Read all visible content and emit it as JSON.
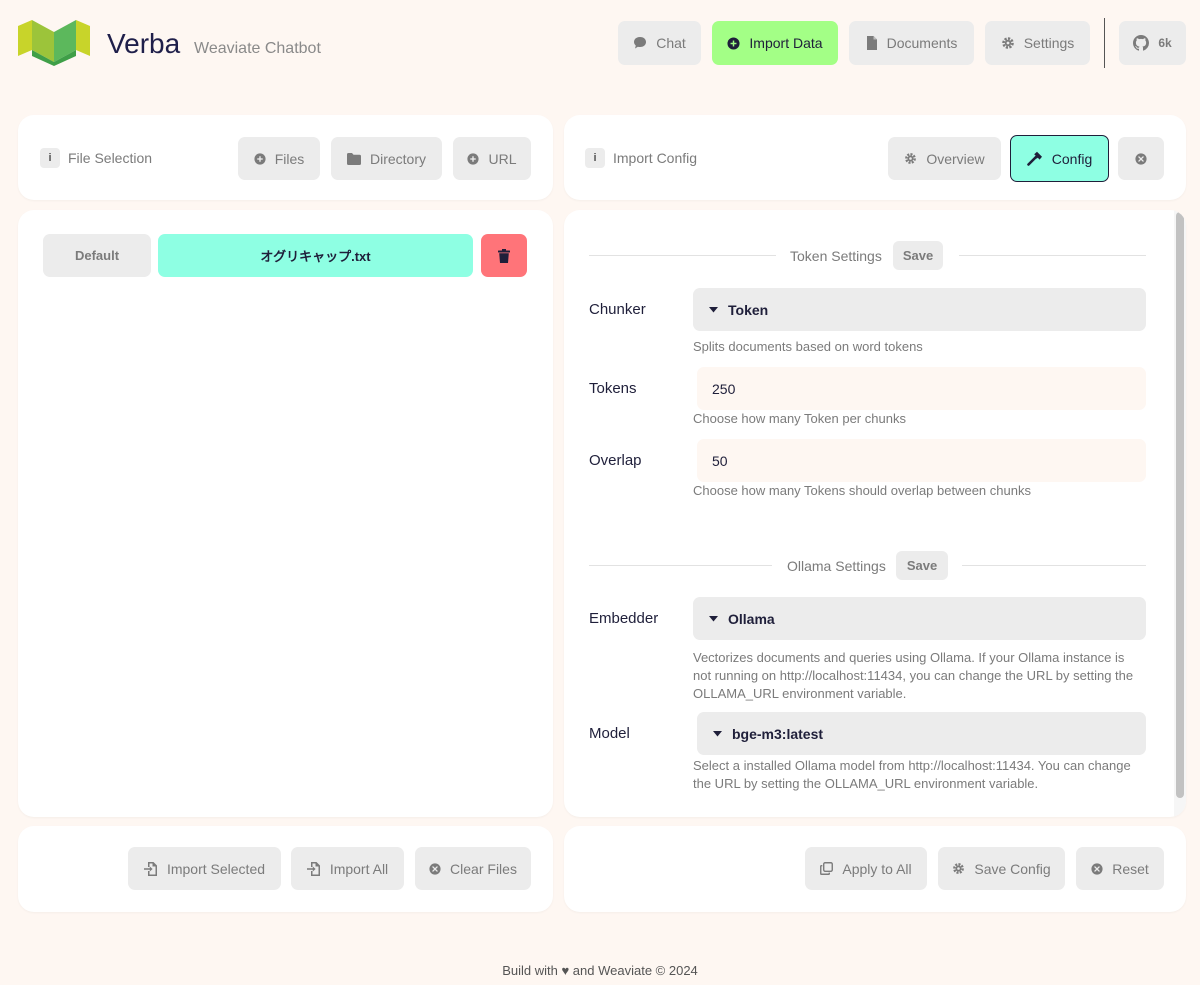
{
  "app": {
    "title": "Verba",
    "subtitle": "Weaviate Chatbot"
  },
  "nav": {
    "chat": "Chat",
    "import_data": "Import Data",
    "documents": "Documents",
    "settings": "Settings",
    "github_count": "6k"
  },
  "file_selection": {
    "label": "File Selection",
    "files": "Files",
    "directory": "Directory",
    "url": "URL"
  },
  "import_config": {
    "label": "Import Config",
    "overview": "Overview",
    "config": "Config"
  },
  "file_list": {
    "default_label": "Default",
    "file_name": "オグリキャップ.txt"
  },
  "token_settings": {
    "title": "Token Settings",
    "save": "Save",
    "chunker_label": "Chunker",
    "chunker_value": "Token",
    "chunker_desc": "Splits documents based on word tokens",
    "tokens_label": "Tokens",
    "tokens_value": "250",
    "tokens_desc": "Choose how many Token per chunks",
    "overlap_label": "Overlap",
    "overlap_value": "50",
    "overlap_desc": "Choose how many Tokens should overlap between chunks"
  },
  "ollama_settings": {
    "title": "Ollama Settings",
    "save": "Save",
    "embedder_label": "Embedder",
    "embedder_value": "Ollama",
    "embedder_desc": "Vectorizes documents and queries using Ollama. If your Ollama instance is not running on http://localhost:11434, you can change the URL by setting the OLLAMA_URL environment variable.",
    "model_label": "Model",
    "model_value": "bge-m3:latest",
    "model_desc": "Select a installed Ollama model from http://localhost:11434. You can change the URL by setting the OLLAMA_URL environment variable."
  },
  "left_actions": {
    "import_selected": "Import Selected",
    "import_all": "Import All",
    "clear_files": "Clear Files"
  },
  "right_actions": {
    "apply_to_all": "Apply to All",
    "save_config": "Save Config",
    "reset": "Reset"
  },
  "footer": {
    "text": "Build with ♥ and Weaviate © 2024"
  },
  "colors": {
    "background": "#fef7f2",
    "import_data_active": "#a3ff86",
    "config_active": "#8effe3",
    "file_selected": "#8effe3",
    "delete": "#ff7479",
    "logo_green": "#4caf50",
    "logo_yellow": "#c8d42a"
  }
}
